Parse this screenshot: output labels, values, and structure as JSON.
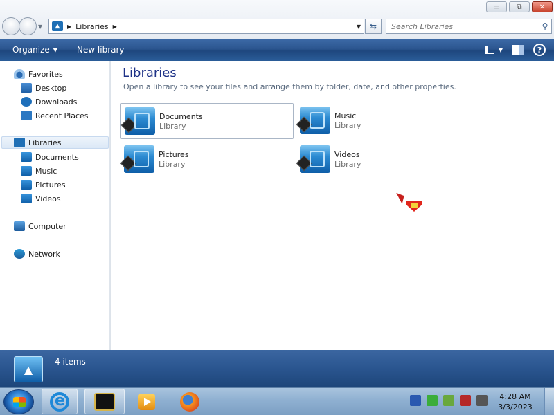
{
  "window": {
    "controls": {
      "minimize": "▭",
      "restore": "⧉",
      "close": "✕"
    }
  },
  "address": {
    "path": [
      "Libraries"
    ],
    "icon": "libraries-icon"
  },
  "search": {
    "placeholder": "Search Libraries"
  },
  "commandbar": {
    "organize": "Organize",
    "new_library": "New library"
  },
  "nav": {
    "favorites": {
      "label": "Favorites",
      "items": [
        {
          "label": "Desktop",
          "icon": "desktop-icon"
        },
        {
          "label": "Downloads",
          "icon": "downloads-icon"
        },
        {
          "label": "Recent Places",
          "icon": "recent-places-icon"
        }
      ]
    },
    "libraries": {
      "label": "Libraries",
      "items": [
        {
          "label": "Documents",
          "icon": "documents-icon"
        },
        {
          "label": "Music",
          "icon": "music-icon"
        },
        {
          "label": "Pictures",
          "icon": "pictures-icon"
        },
        {
          "label": "Videos",
          "icon": "videos-icon"
        }
      ]
    },
    "computer": "Computer",
    "network": "Network"
  },
  "content": {
    "title": "Libraries",
    "description": "Open a library to see your files and arrange them by folder, date, and other properties.",
    "tiles": [
      {
        "name": "Documents",
        "type": "Library",
        "selected": true
      },
      {
        "name": "Music",
        "type": "Library"
      },
      {
        "name": "Pictures",
        "type": "Library"
      },
      {
        "name": "Videos",
        "type": "Library"
      }
    ]
  },
  "details": {
    "count": "4 items"
  },
  "taskbar": {
    "clock_time": "4:28 AM",
    "clock_date": "3/3/2023",
    "apps": [
      "internet-explorer-icon",
      "windows-explorer-icon",
      "media-player-icon",
      "firefox-icon"
    ]
  }
}
